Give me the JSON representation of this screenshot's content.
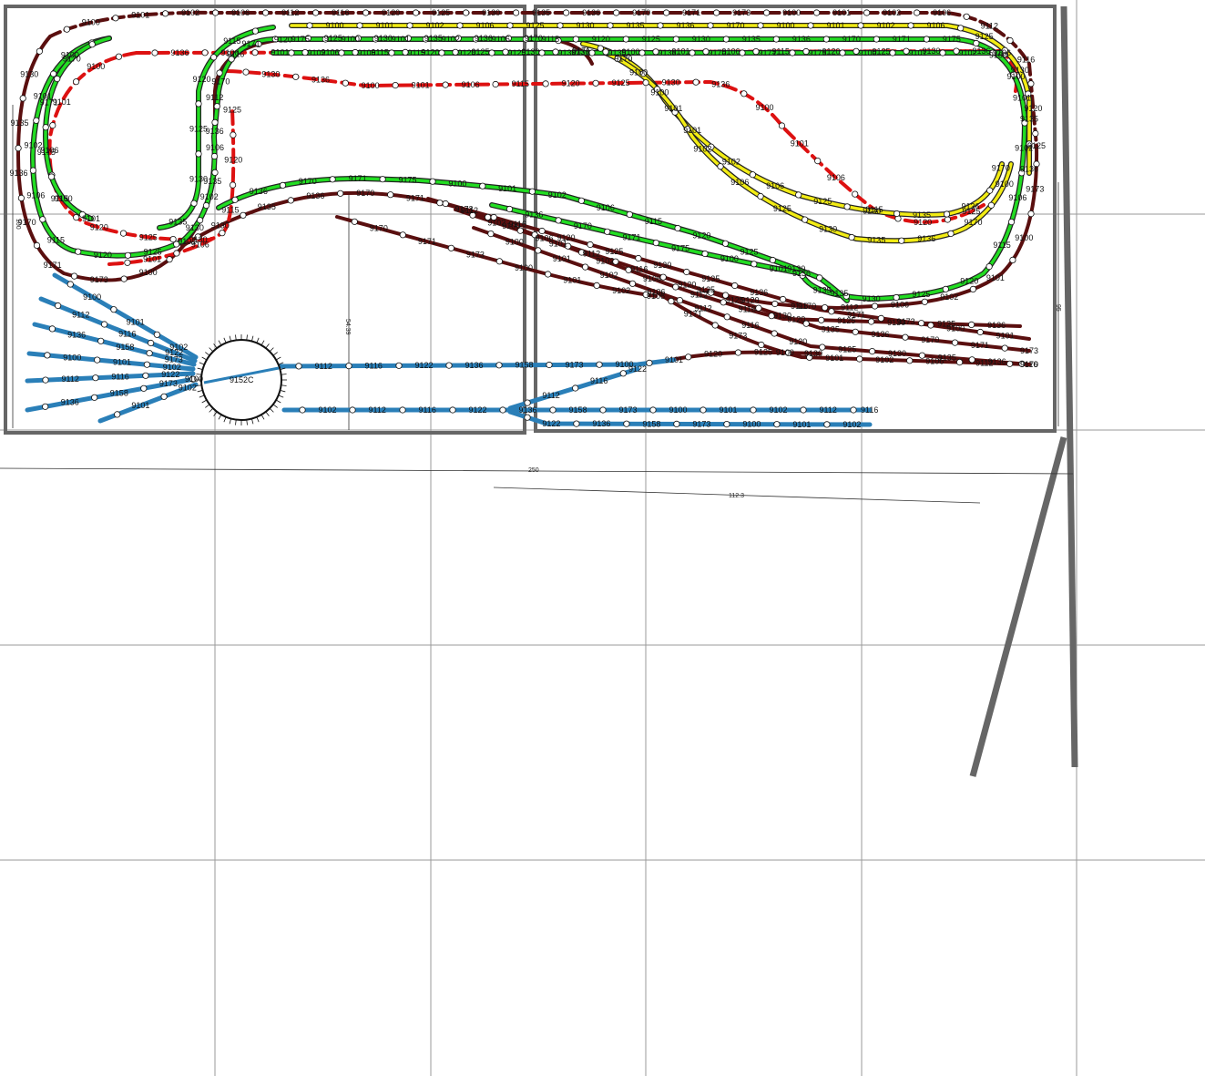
{
  "colors": {
    "green": "#22dd22",
    "yellow": "#f2ec14",
    "red": "#dd1111",
    "maroon": "#5a0f0f",
    "blue": "#2a7fb8",
    "board": "#666666",
    "grid": "#9a9a9a"
  },
  "dimensions": {
    "length_total": "250",
    "length_section": "112.3",
    "height_left": "100",
    "height_right": "95",
    "yard_gap": "54.39"
  },
  "turntable_label": "9152C",
  "track_labels": [
    "9100",
    "9101",
    "9102",
    "9106",
    "9112",
    "9115",
    "9116",
    "9120",
    "9125",
    "9130",
    "9135",
    "9136",
    "9170",
    "9171",
    "9173",
    "9175"
  ],
  "labels": {
    "green": [
      "9100",
      "9101",
      "9102",
      "9106",
      "9115",
      "9120",
      "9125",
      "9130",
      "9135",
      "9136",
      "9170",
      "9171",
      "9175"
    ],
    "yellow": [
      "9100",
      "9101",
      "9102",
      "9106",
      "9125",
      "9130",
      "9135",
      "9136",
      "9170"
    ],
    "red": [
      "9100",
      "9101",
      "9106",
      "9115",
      "9120",
      "9125",
      "9130",
      "9136"
    ],
    "maroon": [
      "9100",
      "9101",
      "9102",
      "9106",
      "9112",
      "9116",
      "9120",
      "9125",
      "9130",
      "9135",
      "9136",
      "9170",
      "9171",
      "9173"
    ],
    "blue": [
      "9100",
      "9101",
      "9102",
      "9112",
      "9116",
      "9122",
      "9136",
      "9158",
      "9173"
    ]
  }
}
